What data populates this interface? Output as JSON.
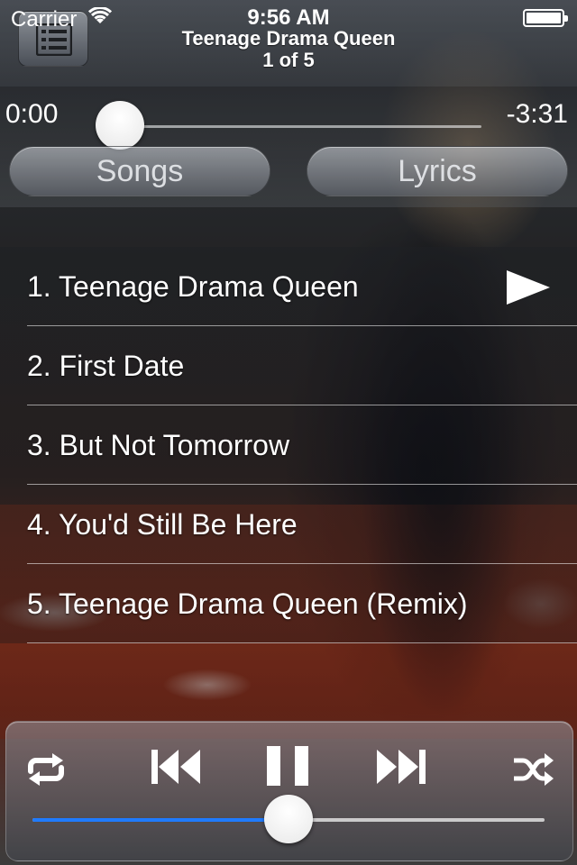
{
  "status_bar": {
    "carrier": "Carrier",
    "time": "9:56 AM"
  },
  "header": {
    "track_title": "Teenage Drama Queen",
    "track_position": "1 of 5",
    "menu_icon": "list-icon"
  },
  "progress": {
    "elapsed": "0:00",
    "remaining": "-3:31",
    "fraction": 0.0
  },
  "tabs": {
    "songs_label": "Songs",
    "lyrics_label": "Lyrics"
  },
  "songs": [
    {
      "label": "1. Teenage Drama Queen",
      "playing": true
    },
    {
      "label": "2. First Date",
      "playing": false
    },
    {
      "label": "3. But Not Tomorrow",
      "playing": false
    },
    {
      "label": "4. You'd Still Be Here",
      "playing": false
    },
    {
      "label": "5. Teenage Drama Queen (Remix)",
      "playing": false
    }
  ],
  "player": {
    "icons": [
      "repeat-icon",
      "previous-track-icon",
      "pause-icon",
      "next-track-icon",
      "shuffle-icon"
    ],
    "volume_fraction": 0.5,
    "accent_color": "#1f7bff"
  }
}
